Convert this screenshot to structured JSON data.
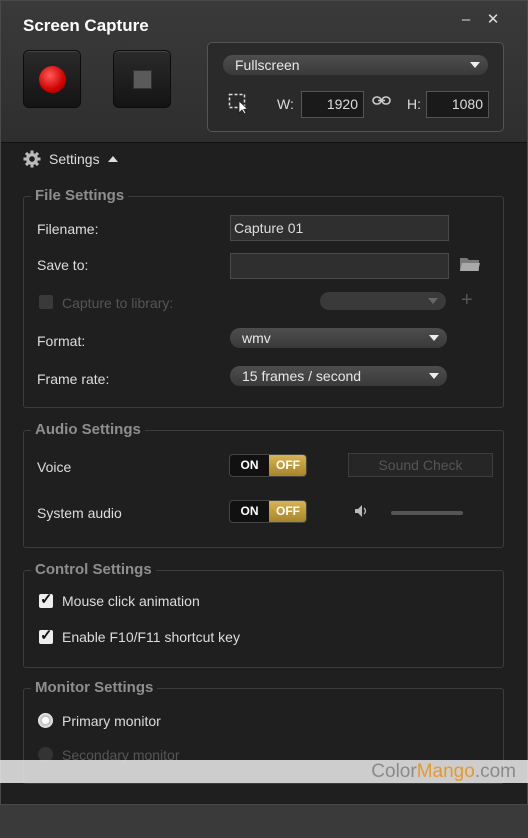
{
  "window": {
    "title": "Screen Capture",
    "minimize_label": "–",
    "close_label": "✕"
  },
  "capture": {
    "mode": "Fullscreen",
    "width_label": "W:",
    "width": "1920",
    "height_label": "H:",
    "height": "1080"
  },
  "settings_toggle": {
    "label": "Settings"
  },
  "file_settings": {
    "title": "File Settings",
    "filename_label": "Filename:",
    "filename_value": "Capture 01",
    "save_to_label": "Save to:",
    "save_to_value": "",
    "capture_library_label": "Capture to library:",
    "format_label": "Format:",
    "format_value": "wmv",
    "frame_rate_label": "Frame rate:",
    "frame_rate_value": "15 frames / second"
  },
  "audio_settings": {
    "title": "Audio Settings",
    "voice_label": "Voice",
    "system_audio_label": "System audio",
    "toggle_on": "ON",
    "toggle_off": "OFF",
    "sound_check_label": "Sound Check"
  },
  "control_settings": {
    "title": "Control Settings",
    "mouse_click_label": "Mouse click animation",
    "shortcut_label": "Enable F10/F11 shortcut key"
  },
  "monitor_settings": {
    "title": "Monitor Settings",
    "primary_label": "Primary monitor",
    "secondary_label": "Secondary monitor"
  },
  "watermark": {
    "prefix": "Color",
    "accent": "Mango",
    "suffix": ".com"
  }
}
